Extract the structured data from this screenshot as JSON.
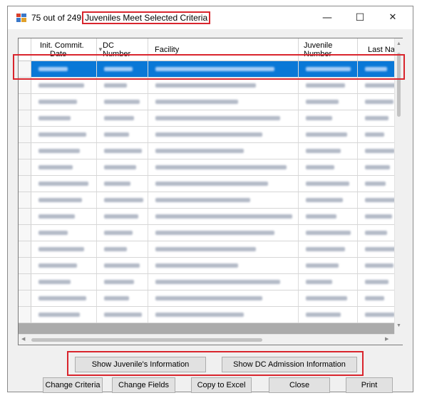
{
  "window": {
    "title_prefix": "75 out of 249",
    "title_highlight": "Juveniles Meet Selected Criteria",
    "minimize_glyph": "—",
    "maximize_glyph": "☐",
    "close_glyph": "✕"
  },
  "grid": {
    "columns": [
      {
        "line1": "Init. Commit.",
        "line2": "Date"
      },
      {
        "line1": "DC",
        "line2": "Number"
      },
      {
        "line1": "Facility",
        "line2": ""
      },
      {
        "line1": "Juvenile",
        "line2": "Number"
      },
      {
        "line1": "Last Na",
        "line2": ""
      }
    ],
    "selected_row": 0,
    "row_count_visible": 16,
    "cell_values_redacted": true
  },
  "buttons": {
    "show_juvenile_info": "Show Juvenile's Information",
    "show_dc_admission_info": "Show DC Admission Information",
    "change_criteria": "Change Criteria",
    "change_fields": "Change Fields",
    "copy_to_excel": "Copy to Excel",
    "close": "Close",
    "print": "Print"
  },
  "colors": {
    "selection": "#0a78d7",
    "highlight_border": "#d9252d",
    "grid_background": "#ababab"
  }
}
